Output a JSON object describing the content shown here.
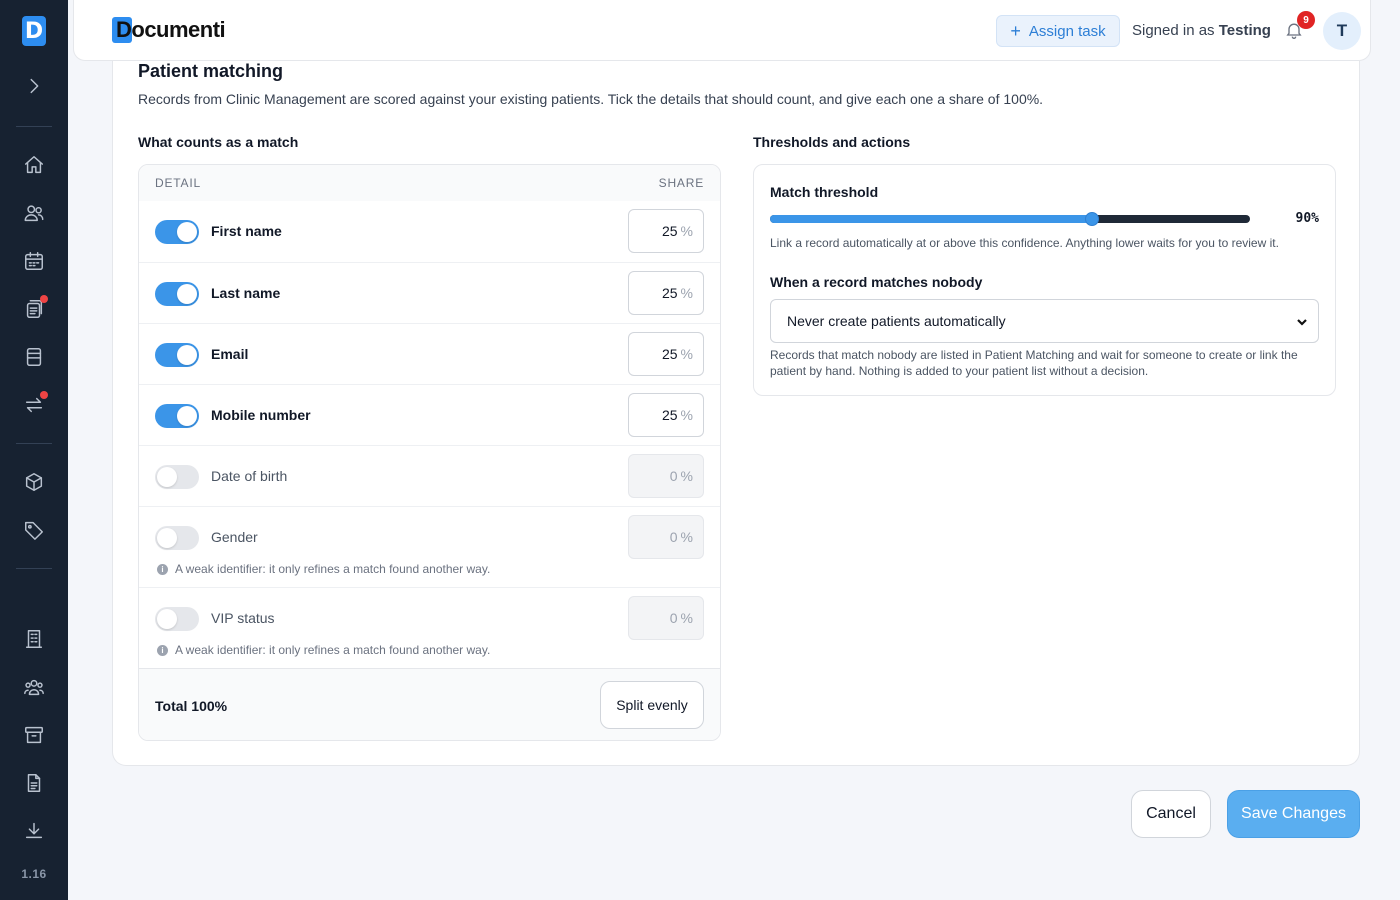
{
  "app": {
    "brand": "Documenti",
    "logo_letter": "D",
    "version": "1.16"
  },
  "header": {
    "assign_task_label": "Assign task",
    "signed_in_prefix": "Signed in as",
    "user_name": "Testing",
    "notification_count": "9",
    "avatar_initial": "T"
  },
  "sidebar": {
    "items": [
      {
        "icon": "expand-icon"
      },
      {
        "icon": "home-icon"
      },
      {
        "icon": "users-icon"
      },
      {
        "icon": "calendar-icon"
      },
      {
        "icon": "documents-icon",
        "has_alert": true
      },
      {
        "icon": "forms-icon"
      },
      {
        "icon": "transfer-icon",
        "has_alert": true
      },
      {
        "icon": "package-icon"
      },
      {
        "icon": "tag-icon"
      },
      {
        "icon": "building-icon"
      },
      {
        "icon": "team-icon"
      },
      {
        "icon": "archive-icon"
      },
      {
        "icon": "file-icon"
      },
      {
        "icon": "download-icon"
      }
    ]
  },
  "page": {
    "title": "Patient matching",
    "description": "Records from Clinic Management are scored against your existing patients. Tick the details that should count, and give each one a share of 100%."
  },
  "match_section": {
    "title": "What counts as a match",
    "col_detail": "DETAIL",
    "col_share": "SHARE",
    "rows": [
      {
        "label": "First name",
        "enabled": true,
        "share": "25",
        "unit": "%"
      },
      {
        "label": "Last name",
        "enabled": true,
        "share": "25",
        "unit": "%"
      },
      {
        "label": "Email",
        "enabled": true,
        "share": "25",
        "unit": "%"
      },
      {
        "label": "Mobile number",
        "enabled": true,
        "share": "25",
        "unit": "%"
      },
      {
        "label": "Date of birth",
        "enabled": false,
        "share": "0",
        "unit": "%"
      },
      {
        "label": "Gender",
        "enabled": false,
        "share": "0",
        "unit": "%",
        "note": "A weak identifier: it only refines a match found another way."
      },
      {
        "label": "VIP status",
        "enabled": false,
        "share": "0",
        "unit": "%",
        "note": "A weak identifier: it only refines a match found another way."
      }
    ],
    "total_label": "Total 100%",
    "split_label": "Split evenly"
  },
  "thresholds": {
    "title": "Thresholds and actions",
    "match_threshold_label": "Match threshold",
    "threshold_value": 90,
    "threshold_display": "90%",
    "threshold_help": "Link a record automatically at or above this confidence. Anything lower waits for you to review it.",
    "nobody_label": "When a record matches nobody",
    "nobody_selected": "Never create patients automatically",
    "nobody_help": "Records that match nobody are listed in Patient Matching and wait for someone to create or link the patient by hand. Nothing is added to your patient list without a decision."
  },
  "actions": {
    "cancel_label": "Cancel",
    "save_label": "Save Changes"
  },
  "colors": {
    "accent": "#3b95e8",
    "sidebar_bg": "#172231",
    "save_bg": "#5aaef0",
    "alert": "#e02424"
  }
}
